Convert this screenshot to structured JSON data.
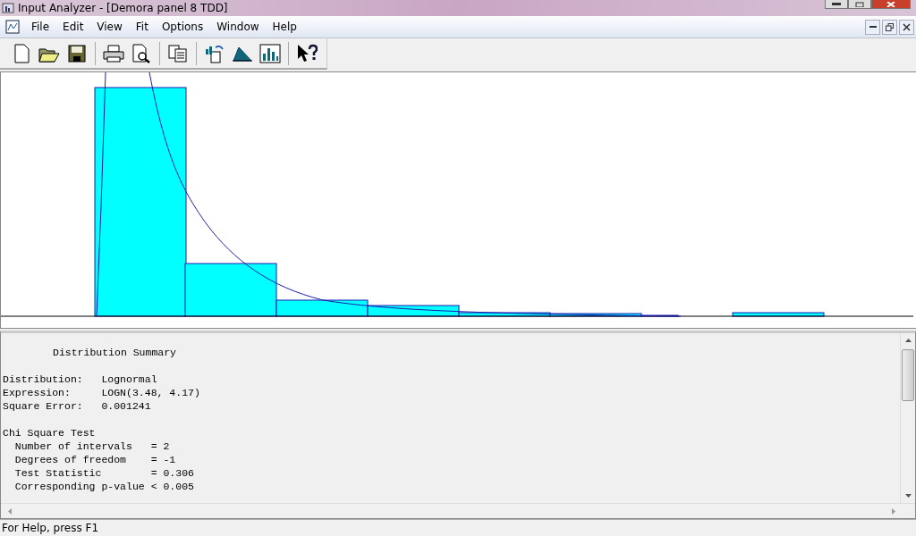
{
  "window": {
    "title": "Input Analyzer - [Demora panel 8 TDD]"
  },
  "menu": [
    {
      "label": "File"
    },
    {
      "label": "Edit"
    },
    {
      "label": "View"
    },
    {
      "label": "Fit"
    },
    {
      "label": "Options"
    },
    {
      "label": "Window"
    },
    {
      "label": "Help"
    }
  ],
  "summary": {
    "lines": [
      {
        "kind": "heading",
        "text": "Distribution Summary"
      },
      {
        "kind": "gap"
      },
      {
        "kind": "line",
        "text": "Distribution:   Lognormal"
      },
      {
        "kind": "line",
        "text": "Expression:     LOGN(3.48, 4.17)"
      },
      {
        "kind": "line",
        "text": "Square Error:   0.001241"
      },
      {
        "kind": "gap"
      },
      {
        "kind": "line",
        "text": "Chi Square Test"
      },
      {
        "kind": "line",
        "text": "  Number of intervals   = 2"
      },
      {
        "kind": "line",
        "text": "  Degrees of freedom    = -1"
      },
      {
        "kind": "line",
        "text": "  Test Statistic        = 0.306"
      },
      {
        "kind": "line",
        "text": "  Corresponding p-value < 0.005"
      }
    ]
  },
  "status_bar": {
    "text": "For Help, press F1"
  }
}
